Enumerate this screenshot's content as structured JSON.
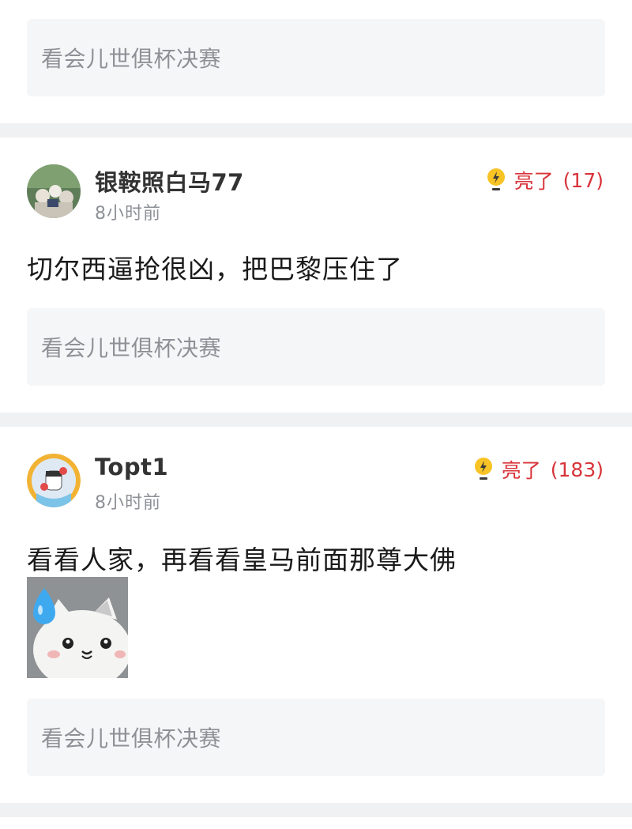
{
  "quote_text": "看会儿世俱杯决赛",
  "comments": [
    {
      "username": "银鞍照白马77",
      "time": "8小时前",
      "like_label": "亮了",
      "like_count": "(17)",
      "text": "切尔西逼抢很凶，把巴黎压住了",
      "quote": "看会儿世俱杯决赛"
    },
    {
      "username": "Topt1",
      "time": "8小时前",
      "like_label": "亮了",
      "like_count": "(183)",
      "text": "看看人家，再看看皇马前面那尊大佛",
      "quote": "看会儿世俱杯决赛"
    }
  ],
  "icons": {
    "like": "lightbulb-icon",
    "sticker": "crying-hamster-sticker"
  },
  "colors": {
    "like_accent": "#d8343a",
    "bulb_yellow": "#f7c325",
    "quote_bg": "#f5f6f7",
    "divider_bg": "#f0f1f3"
  }
}
